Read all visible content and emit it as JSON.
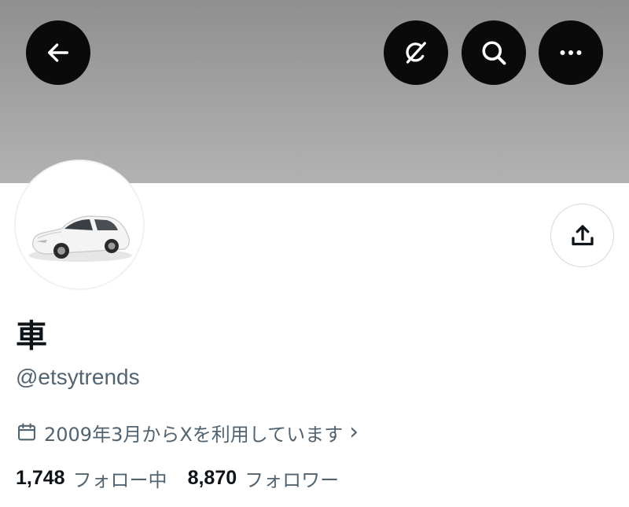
{
  "header": {
    "back_icon": "arrow-left-icon",
    "grok_icon": "grok-icon",
    "search_icon": "search-icon",
    "more_icon": "more-horizontal-icon",
    "button_color": "#0a0a0a",
    "banner_color": "#a0a0a0"
  },
  "profile": {
    "avatar_icon": "white-car-avatar",
    "share_icon": "share-upload-icon",
    "display_name": "車",
    "handle": "@etsytrends",
    "joined_icon": "calendar-icon",
    "joined_text": "2009年3月からXを利用しています",
    "joined_chevron": "›",
    "following_count": "1,748",
    "following_label": "フォロー中",
    "followers_count": "8,870",
    "followers_label": "フォロワー"
  },
  "colors": {
    "text_primary": "#0f1419",
    "text_secondary": "#536471",
    "border": "#cfd9de"
  }
}
